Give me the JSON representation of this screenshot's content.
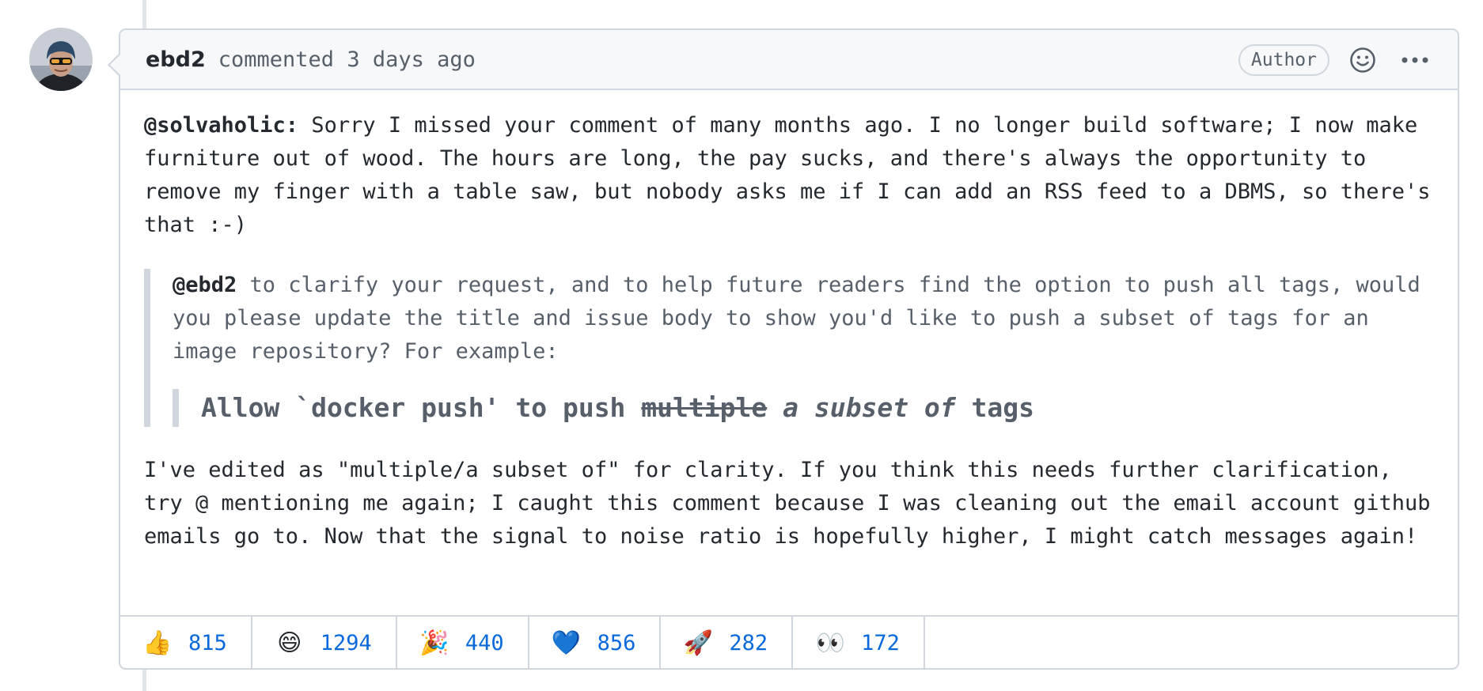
{
  "comment": {
    "author": "ebd2",
    "meta": "commented 3 days ago",
    "badge": "Author",
    "body": {
      "p1_mention": "@solvaholic:",
      "p1_text": " Sorry I missed your comment of many months ago. I no longer build software; I now make furniture out of wood. The hours are long, the pay sucks, and there's always the opportunity to remove my finger with a table saw, but nobody asks me if I can add an RSS feed to a DBMS, so there's that :-)",
      "quote_mention": "@ebd2",
      "quote_text": " to clarify your request, and to help future readers find the option to push all tags, would you please update the title and issue body to show you'd like to push a subset of tags for an image repository? For example:",
      "nested_pre": "Allow `docker push' to push ",
      "nested_strike": "multiple",
      "nested_em": " a subset of",
      "nested_post": " tags",
      "p2_text": "I've edited as \"multiple/a subset of\" for clarity. If you think this needs further clarification, try @ mentioning me again; I caught this comment because I was cleaning out the email account github emails go to. Now that the signal to noise ratio is hopefully higher, I might catch messages again!"
    }
  },
  "reactions": [
    {
      "emoji": "👍",
      "icon": "thumbs-up-icon",
      "count": "815"
    },
    {
      "emoji": "😄",
      "icon": "laugh-icon",
      "count": "1294"
    },
    {
      "emoji": "🎉",
      "icon": "hooray-icon",
      "count": "440"
    },
    {
      "emoji": "💙",
      "icon": "heart-icon",
      "count": "856"
    },
    {
      "emoji": "🚀",
      "icon": "rocket-icon",
      "count": "282"
    },
    {
      "emoji": "👀",
      "icon": "eyes-icon",
      "count": "172"
    }
  ],
  "colors": {
    "accent": "#0969da",
    "border": "#d0d7de",
    "header_bg": "#f6f8fa",
    "heart": "#0969da"
  }
}
